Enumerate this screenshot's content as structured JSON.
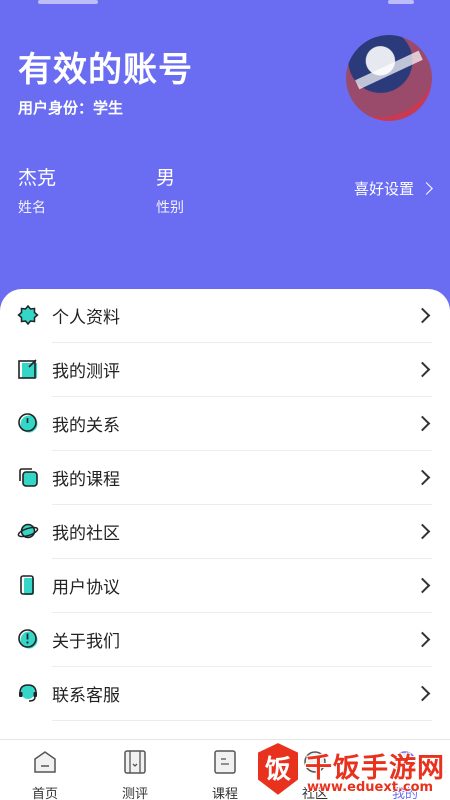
{
  "header": {
    "account_title": "有效的账号",
    "identity": "用户身份：学生",
    "name_value": "杰克",
    "name_label": "姓名",
    "gender_value": "男",
    "gender_label": "性别",
    "preferences": "喜好设置",
    "bg_color": "#6a6df2"
  },
  "menu": {
    "items": [
      {
        "label": "个人资料",
        "icon": "badge-star-icon"
      },
      {
        "label": "我的测评",
        "icon": "edit-note-icon"
      },
      {
        "label": "我的关系",
        "icon": "clock-circle-icon"
      },
      {
        "label": "我的课程",
        "icon": "stacked-squares-icon"
      },
      {
        "label": "我的社区",
        "icon": "planet-icon"
      },
      {
        "label": "用户协议",
        "icon": "phone-document-icon"
      },
      {
        "label": "关于我们",
        "icon": "info-exclamation-icon"
      },
      {
        "label": "联系客服",
        "icon": "headset-icon"
      }
    ],
    "accent_color": "#34d6c8"
  },
  "tabbar": {
    "tabs": [
      {
        "label": "首页",
        "icon": "home-icon"
      },
      {
        "label": "测评",
        "icon": "assessment-icon"
      },
      {
        "label": "课程",
        "icon": "course-icon"
      },
      {
        "label": "社区",
        "icon": "community-icon"
      },
      {
        "label": "我的",
        "icon": "profile-icon",
        "active": true
      }
    ]
  },
  "watermark": {
    "badge_char": "饭",
    "text": "千饭手游网",
    "url": "www.eduext.com",
    "color": "#e8321e"
  }
}
